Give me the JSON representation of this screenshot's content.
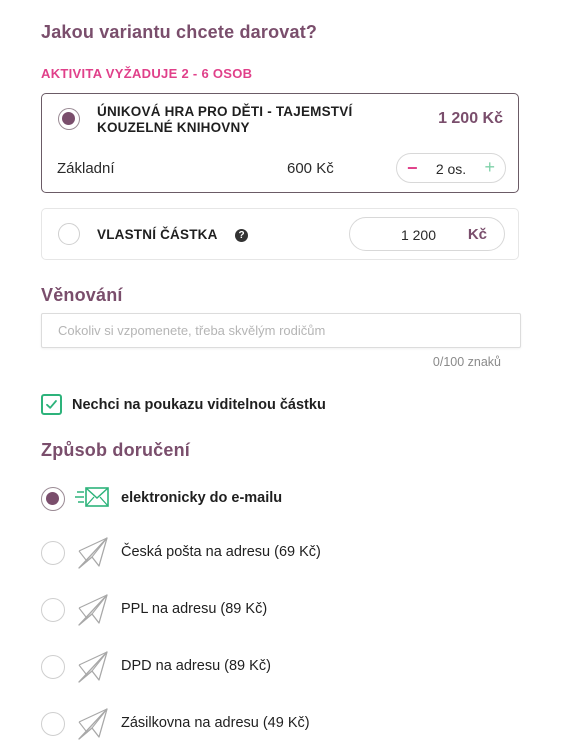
{
  "variant": {
    "heading": "Jakou variantu chcete darovat?",
    "requirement": "AKTIVITA VYŽADUJE 2 - 6 OSOB",
    "option": {
      "title_line1": "ÚNIKOVÁ HRA PRO DĚTI - TAJEMSTVÍ",
      "title_line2": "KOUZELNÉ KNIHOVNY",
      "price": "1 200 Kč",
      "tier_label": "Základní",
      "tier_price": "600 Kč",
      "stepper_minus": "−",
      "stepper_value": "2 os.",
      "stepper_plus": "+"
    },
    "custom": {
      "label": "VLASTNÍ ČÁSTKA",
      "help": "?",
      "amount": "1 200",
      "currency": "Kč"
    }
  },
  "dedication": {
    "heading": "Věnování",
    "placeholder": "Cokoliv si vzpomenete, třeba skvělým rodičům",
    "counter": "0/100 znaků"
  },
  "hide_amount": {
    "label": "Nechci na poukazu viditelnou částku",
    "checked": true
  },
  "delivery": {
    "heading": "Způsob doručení",
    "options": [
      {
        "label": "elektronicky do e-mailu",
        "icon": "email-send-icon",
        "selected": true
      },
      {
        "label": "Česká pošta na adresu (69 Kč)",
        "icon": "paper-plane-icon",
        "selected": false
      },
      {
        "label": "PPL na adresu (89 Kč)",
        "icon": "paper-plane-icon",
        "selected": false
      },
      {
        "label": "DPD na adresu (89 Kč)",
        "icon": "paper-plane-icon",
        "selected": false
      },
      {
        "label": "Zásilkovna na adresu (49 Kč)",
        "icon": "paper-plane-icon",
        "selected": false
      }
    ]
  },
  "colors": {
    "accent": "#7a4e6c",
    "pink": "#e0408a",
    "green": "#2db37b"
  }
}
